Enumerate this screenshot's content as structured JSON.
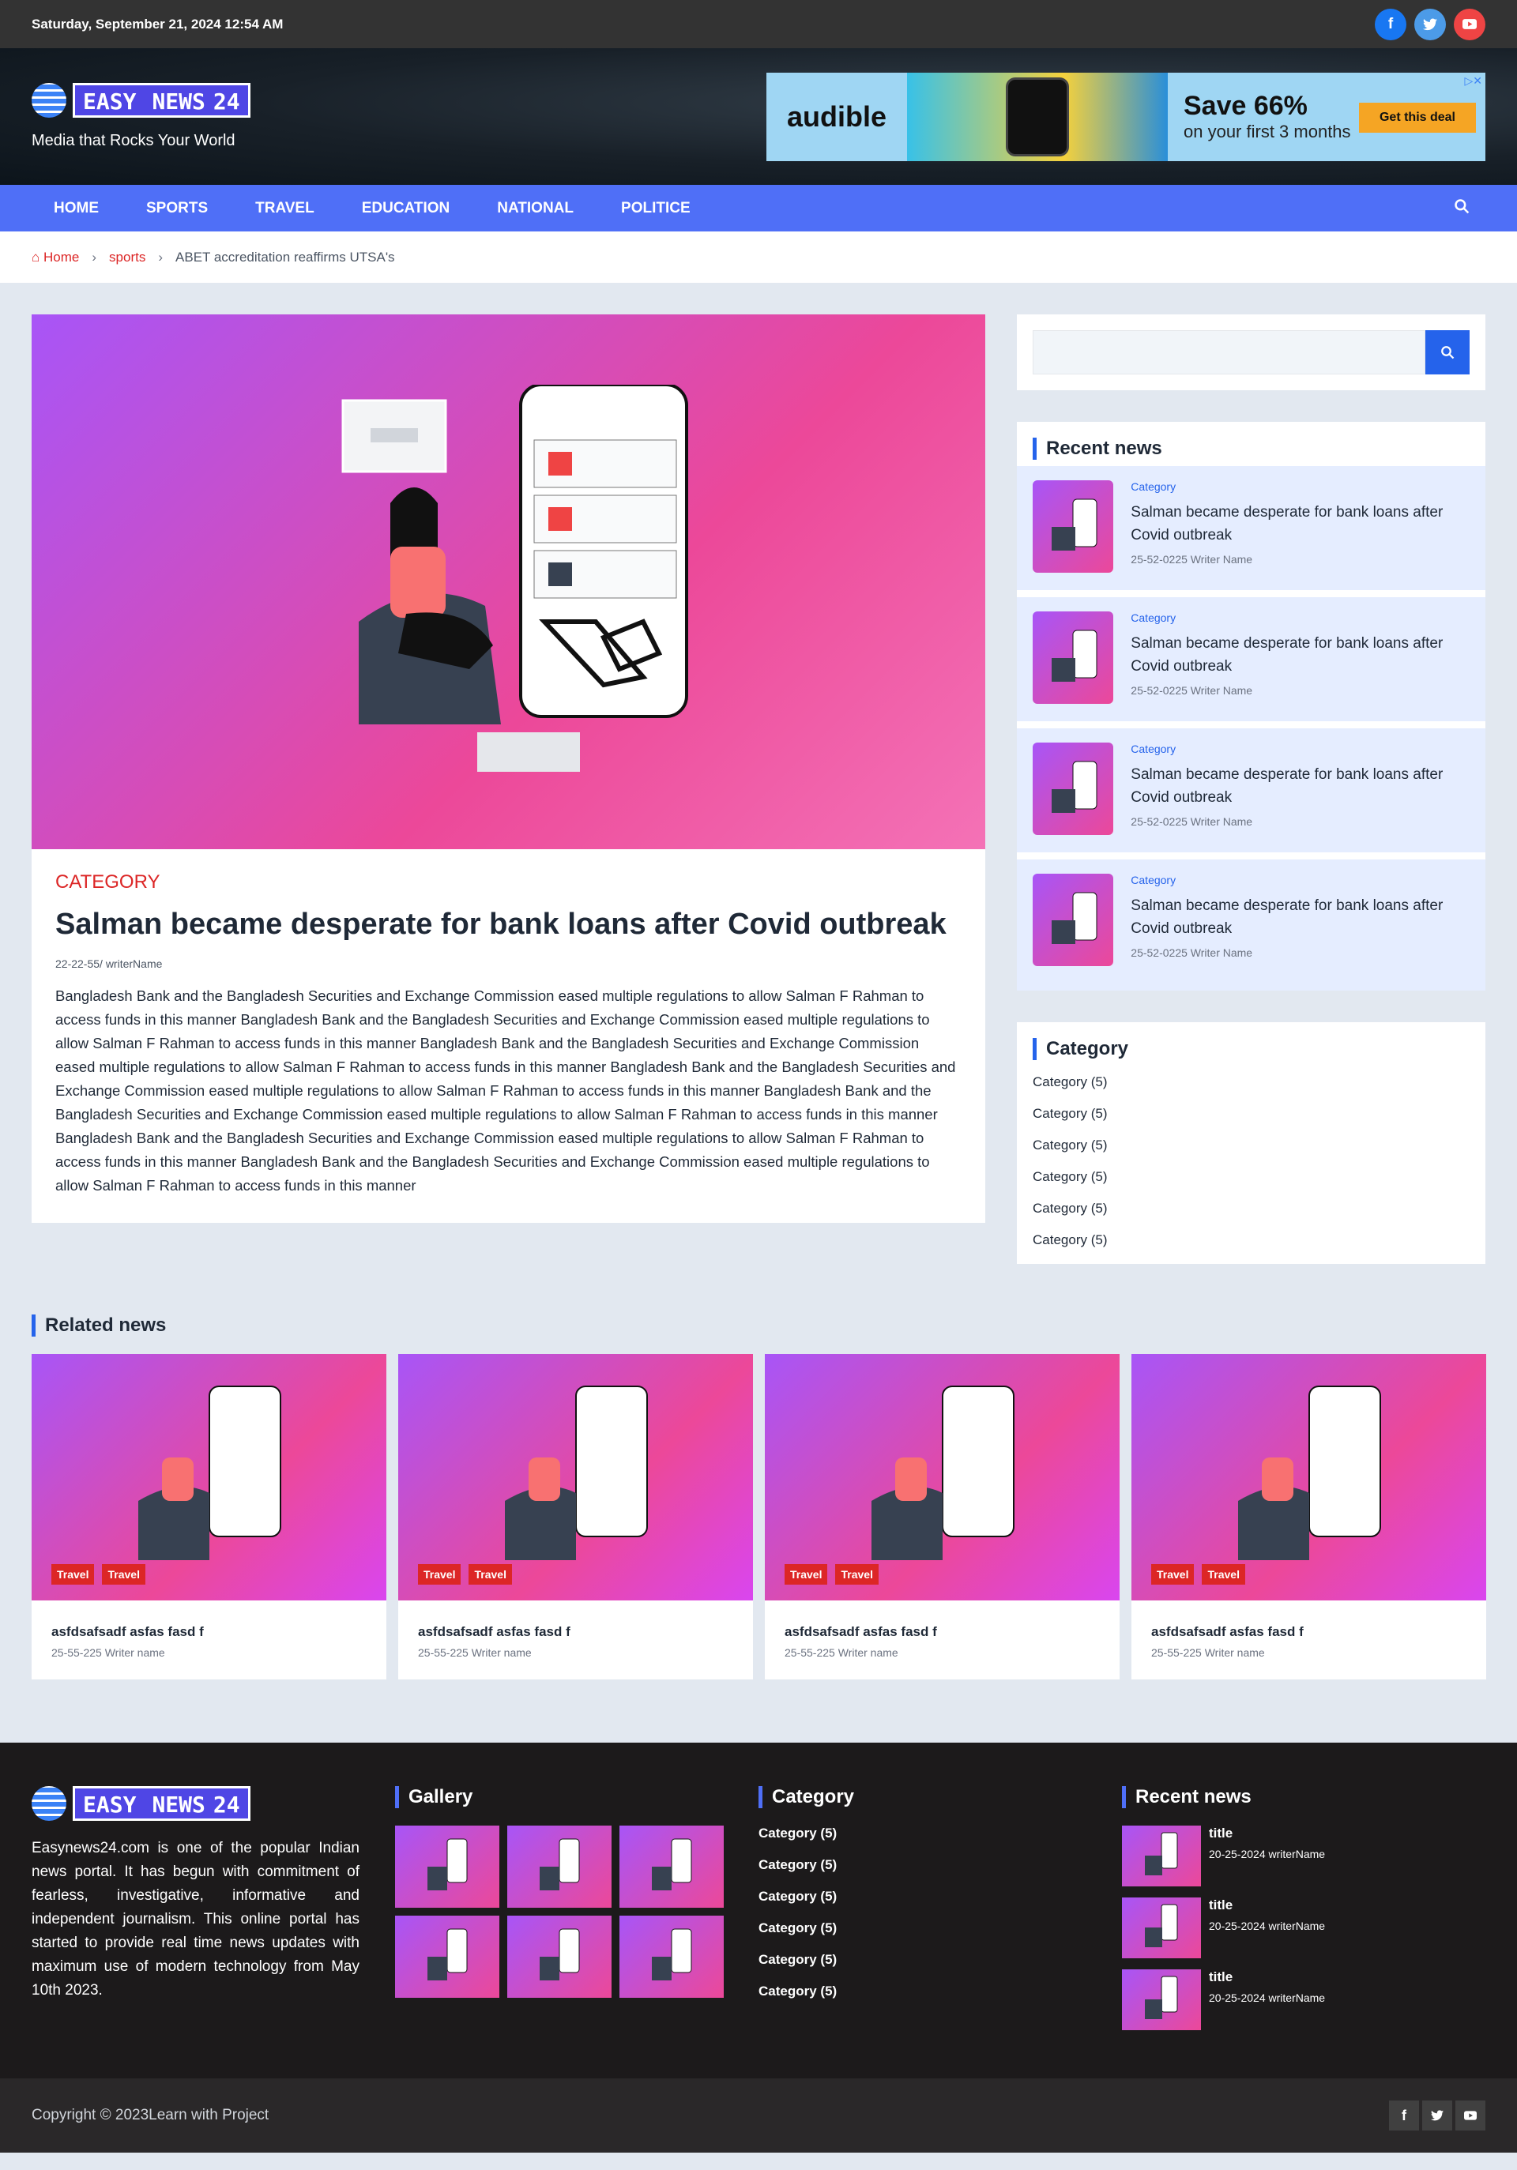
{
  "topbar": {
    "date": "Saturday, September 21, 2024 12:54 AM"
  },
  "header": {
    "logo_part1": "EASY",
    "logo_part2": "NEWS",
    "logo_part3": "24",
    "tagline": "Media that Rocks Your World",
    "ad": {
      "brand": "audible",
      "headline": "Save 66%",
      "sub": "on your first 3 months",
      "cta": "Get this deal"
    }
  },
  "nav": {
    "items": [
      "HOME",
      "SPORTS",
      "TRAVEL",
      "EDUCATION",
      "NATIONAL",
      "POLITICE"
    ]
  },
  "breadcrumb": {
    "home": "Home",
    "section": "sports",
    "current": "ABET accreditation reaffirms UTSA's"
  },
  "article": {
    "category": "CATEGORY",
    "title": "Salman became desperate for bank loans after Covid outbreak",
    "meta": "22-22-55/  writerName",
    "body": "Bangladesh Bank and the Bangladesh Securities and Exchange Commission eased multiple regulations to allow Salman F Rahman to access funds in this manner Bangladesh Bank and the Bangladesh Securities and Exchange Commission eased multiple regulations to allow Salman F Rahman to access funds in this manner Bangladesh Bank and the Bangladesh Securities and Exchange Commission eased multiple regulations to allow Salman F Rahman to access funds in this manner Bangladesh Bank and the Bangladesh Securities and Exchange Commission eased multiple regulations to allow Salman F Rahman to access funds in this manner Bangladesh Bank and the Bangladesh Securities and Exchange Commission eased multiple regulations to allow Salman F Rahman to access funds in this manner Bangladesh Bank and the Bangladesh Securities and Exchange Commission eased multiple regulations to allow Salman F Rahman to access funds in this manner Bangladesh Bank and the Bangladesh Securities and Exchange Commission eased multiple regulations to allow Salman F Rahman to access funds in this manner"
  },
  "sidebar": {
    "recent_title": "Recent news",
    "recent": [
      {
        "category": "Category",
        "title": "Salman became desperate for bank loans after Covid outbreak",
        "meta": "25-52-0225    Writer Name"
      },
      {
        "category": "Category",
        "title": "Salman became desperate for bank loans after Covid outbreak",
        "meta": "25-52-0225    Writer Name"
      },
      {
        "category": "Category",
        "title": "Salman became desperate for bank loans after Covid outbreak",
        "meta": "25-52-0225    Writer Name"
      },
      {
        "category": "Category",
        "title": "Salman became desperate for bank loans after Covid outbreak",
        "meta": "25-52-0225    Writer Name"
      }
    ],
    "category_title": "Category",
    "categories": [
      "Category (5)",
      "Category (5)",
      "Category (5)",
      "Category (5)",
      "Category (5)",
      "Category (5)"
    ]
  },
  "related": {
    "title": "Related news",
    "cards": [
      {
        "tag1": "Travel",
        "tag2": "Travel",
        "title": "asfdsafsadf asfas fasd f",
        "meta": "25-55-225    Writer name"
      },
      {
        "tag1": "Travel",
        "tag2": "Travel",
        "title": "asfdsafsadf asfas fasd f",
        "meta": "25-55-225    Writer name"
      },
      {
        "tag1": "Travel",
        "tag2": "Travel",
        "title": "asfdsafsadf asfas fasd f",
        "meta": "25-55-225    Writer name"
      },
      {
        "tag1": "Travel",
        "tag2": "Travel",
        "title": "asfdsafsadf asfas fasd f",
        "meta": "25-55-225    Writer name"
      }
    ]
  },
  "footer": {
    "about": "Easynews24.com is one of the popular Indian news portal. It has begun with commitment of fearless, investigative, informative and independent journalism. This online portal has started to provide real time news updates with maximum use of modern technology from May 10th 2023.",
    "gallery_title": "Gallery",
    "category_title": "Category",
    "categories": [
      "Category (5)",
      "Category (5)",
      "Category (5)",
      "Category (5)",
      "Category (5)",
      "Category (5)"
    ],
    "recent_title": "Recent news",
    "recent": [
      {
        "title": "title",
        "meta": "20-25-2024   writerName"
      },
      {
        "title": "title",
        "meta": "20-25-2024   writerName"
      },
      {
        "title": "title",
        "meta": "20-25-2024   writerName"
      }
    ],
    "copyright": "Copyright © 2023Learn with Project"
  },
  "colors": {
    "nav": "#4f6ff7",
    "accent_red": "#dc2626",
    "accent_blue": "#2563eb",
    "footer": "#1c1a1b"
  },
  "icons": {
    "facebook": "facebook-icon",
    "twitter": "twitter-icon",
    "youtube": "youtube-icon",
    "search": "search-icon",
    "home": "home-icon"
  }
}
